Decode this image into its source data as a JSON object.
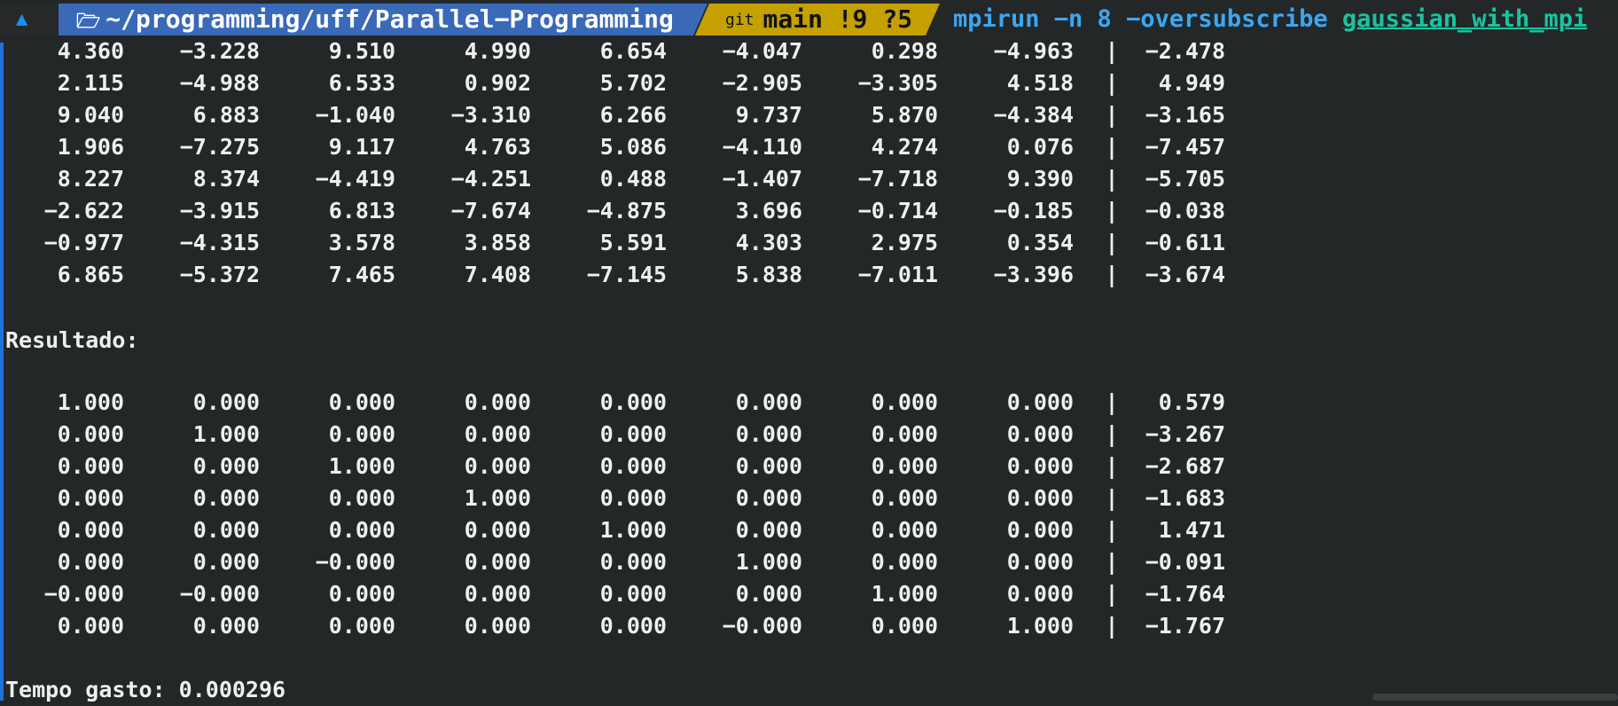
{
  "prompt": {
    "os_icon": "arch-linux-icon",
    "folder_icon": "folder-open-icon",
    "path": "~/programming/uff/Parallel-Programming",
    "git_label": "git",
    "git_status": "main !9 ?5",
    "command": "mpirun -n 8 -oversubscribe ",
    "command_arg": "gaussian_with_mpi",
    "colors": {
      "path_bg": "#3a69b8",
      "git_bg": "#c4a000",
      "command": "#3ba7f2",
      "arg": "#19c4a0"
    }
  },
  "input_matrix": [
    {
      "cols": [
        "4.360",
        "-3.228",
        "9.510",
        "4.990",
        "6.654",
        "-4.047",
        "0.298",
        "-4.963"
      ],
      "rhs": "-2.478"
    },
    {
      "cols": [
        "2.115",
        "-4.988",
        "6.533",
        "0.902",
        "5.702",
        "-2.905",
        "-3.305",
        "4.518"
      ],
      "rhs": "4.949"
    },
    {
      "cols": [
        "9.040",
        "6.883",
        "-1.040",
        "-3.310",
        "6.266",
        "9.737",
        "5.870",
        "-4.384"
      ],
      "rhs": "-3.165"
    },
    {
      "cols": [
        "1.906",
        "-7.275",
        "9.117",
        "4.763",
        "5.086",
        "-4.110",
        "4.274",
        "0.076"
      ],
      "rhs": "-7.457"
    },
    {
      "cols": [
        "8.227",
        "8.374",
        "-4.419",
        "-4.251",
        "0.488",
        "-1.407",
        "-7.718",
        "9.390"
      ],
      "rhs": "-5.705"
    },
    {
      "cols": [
        "-2.622",
        "-3.915",
        "6.813",
        "-7.674",
        "-4.875",
        "3.696",
        "-0.714",
        "-0.185"
      ],
      "rhs": "-0.038"
    },
    {
      "cols": [
        "-0.977",
        "-4.315",
        "3.578",
        "3.858",
        "5.591",
        "4.303",
        "2.975",
        "0.354"
      ],
      "rhs": "-0.611"
    },
    {
      "cols": [
        "6.865",
        "-5.372",
        "7.465",
        "7.408",
        "-7.145",
        "5.838",
        "-7.011",
        "-3.396"
      ],
      "rhs": "-3.674"
    }
  ],
  "result_label": "Resultado:",
  "result_matrix": [
    {
      "cols": [
        "1.000",
        "0.000",
        "0.000",
        "0.000",
        "0.000",
        "0.000",
        "0.000",
        "0.000"
      ],
      "rhs": "0.579"
    },
    {
      "cols": [
        "0.000",
        "1.000",
        "0.000",
        "0.000",
        "0.000",
        "0.000",
        "0.000",
        "0.000"
      ],
      "rhs": "-3.267"
    },
    {
      "cols": [
        "0.000",
        "0.000",
        "1.000",
        "0.000",
        "0.000",
        "0.000",
        "0.000",
        "0.000"
      ],
      "rhs": "-2.687"
    },
    {
      "cols": [
        "0.000",
        "0.000",
        "0.000",
        "1.000",
        "0.000",
        "0.000",
        "0.000",
        "0.000"
      ],
      "rhs": "-1.683"
    },
    {
      "cols": [
        "0.000",
        "0.000",
        "0.000",
        "0.000",
        "1.000",
        "0.000",
        "0.000",
        "0.000"
      ],
      "rhs": "1.471"
    },
    {
      "cols": [
        "0.000",
        "0.000",
        "-0.000",
        "0.000",
        "0.000",
        "1.000",
        "0.000",
        "0.000"
      ],
      "rhs": "-0.091"
    },
    {
      "cols": [
        "-0.000",
        "-0.000",
        "0.000",
        "0.000",
        "0.000",
        "0.000",
        "1.000",
        "0.000"
      ],
      "rhs": "-1.764"
    },
    {
      "cols": [
        "0.000",
        "0.000",
        "0.000",
        "0.000",
        "0.000",
        "-0.000",
        "0.000",
        "1.000"
      ],
      "rhs": "-1.767"
    }
  ],
  "separator": "|",
  "time_line": "Tempo gasto: 0.000296"
}
